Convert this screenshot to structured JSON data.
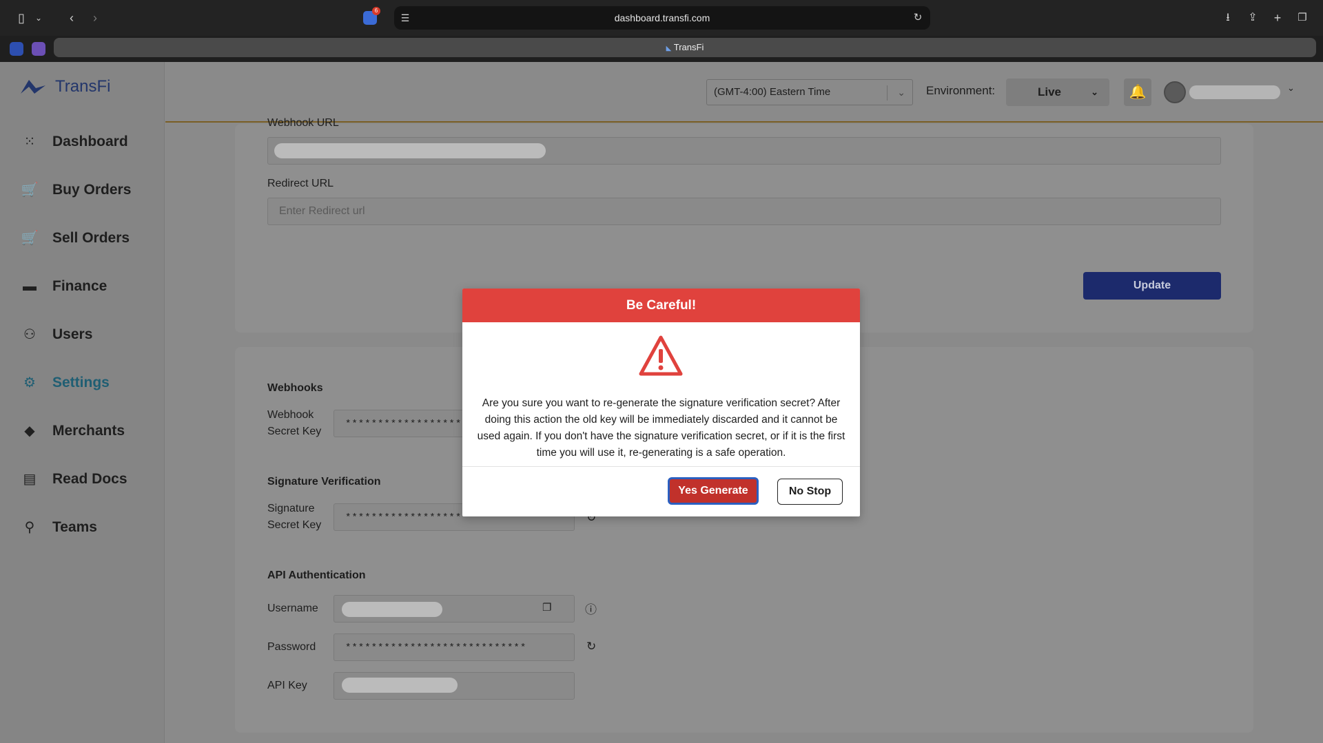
{
  "browser": {
    "url": "dashboard.transfi.com",
    "tab_title": "TransFi",
    "badge_count": "6"
  },
  "sidebar": {
    "brand": "TransFi",
    "items": [
      {
        "label": "Dashboard",
        "icon": "grid-icon"
      },
      {
        "label": "Buy Orders",
        "icon": "cart-icon"
      },
      {
        "label": "Sell Orders",
        "icon": "cart-icon"
      },
      {
        "label": "Finance",
        "icon": "wallet-icon"
      },
      {
        "label": "Users",
        "icon": "users-icon"
      },
      {
        "label": "Settings",
        "icon": "gear-icon",
        "active": true
      },
      {
        "label": "Merchants",
        "icon": "cube-icon"
      },
      {
        "label": "Read Docs",
        "icon": "document-icon"
      },
      {
        "label": "Teams",
        "icon": "team-icon"
      }
    ]
  },
  "header": {
    "timezone": "(GMT-4:00) Eastern Time",
    "environment_label": "Environment:",
    "environment_value": "Live"
  },
  "form": {
    "webhook_url_label": "Webhook URL",
    "redirect_url_label": "Redirect URL",
    "redirect_url_placeholder": "Enter Redirect url",
    "update_label": "Update"
  },
  "secrets": {
    "webhooks_title": "Webhooks",
    "webhook_secret_label_1": "Webhook",
    "webhook_secret_label_2": "Secret Key",
    "webhook_secret_mask": "*************************",
    "signature_title": "Signature Verification",
    "signature_secret_label_1": "Signature",
    "signature_secret_label_2": "Secret Key",
    "signature_secret_mask": "**************************",
    "api_title": "API Authentication",
    "username_label": "Username",
    "password_label": "Password",
    "password_mask": "****************************",
    "api_key_label": "API Key"
  },
  "modal": {
    "title": "Be Careful!",
    "message": "Are you sure you want to re-generate the signature verification secret? After doing this action the old key will be immediately discarded and it cannot be used again. If you don't have the signature verification secret, or if it is the first time you will use it, re-generating is a safe operation.",
    "confirm_label": "Yes Generate",
    "cancel_label": "No Stop",
    "header_color": "#e0423d",
    "confirm_color": "#c1312b"
  }
}
